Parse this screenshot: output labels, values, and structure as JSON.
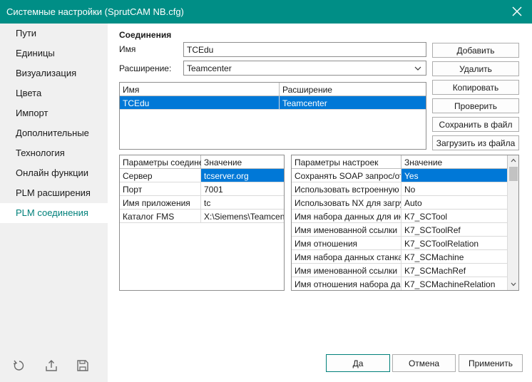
{
  "window": {
    "title": "Системные настройки (SprutCAM NB.cfg)"
  },
  "sidebar": {
    "items": [
      {
        "label": "Пути"
      },
      {
        "label": "Единицы"
      },
      {
        "label": "Визуализация"
      },
      {
        "label": "Цвета"
      },
      {
        "label": "Импорт"
      },
      {
        "label": "Дополнительные"
      },
      {
        "label": "Технология"
      },
      {
        "label": "Онлайн функции"
      },
      {
        "label": "PLM расширения"
      },
      {
        "label": "PLM соединения"
      }
    ],
    "active_index": 9
  },
  "connections": {
    "section_title": "Соединения",
    "name_label": "Имя",
    "name_value": "TCEdu",
    "extension_label": "Расширение:",
    "extension_value": "Teamcenter",
    "table": {
      "columns": [
        "Имя",
        "Расширение"
      ],
      "rows": [
        {
          "name": "TCEdu",
          "extension": "Teamcenter",
          "selected": true
        }
      ]
    },
    "buttons": {
      "add": "Добавить",
      "delete": "Удалить",
      "copy": "Копировать",
      "check": "Проверить",
      "save_file": "Сохранить в файл",
      "load_file": "Загрузить из файла"
    }
  },
  "conn_params": {
    "columns": [
      "Параметры соединения",
      "Значение"
    ],
    "rows": [
      {
        "param": "Сервер",
        "value": "tcserver.org",
        "selected": true
      },
      {
        "param": "Порт",
        "value": "7001",
        "selected": false
      },
      {
        "param": "Имя приложения",
        "value": "tc",
        "selected": false
      },
      {
        "param": "Каталог FMS",
        "value": "X:\\Siemens\\Teamcenter",
        "selected": false
      }
    ]
  },
  "settings_params": {
    "columns": [
      "Параметры настроек",
      "Значение"
    ],
    "rows": [
      {
        "param": "Сохранять SOAP запрос/ответ",
        "value": "Yes",
        "selected": true
      },
      {
        "param": "Использовать встроенную",
        "value": "No",
        "selected": false
      },
      {
        "param": "Использовать NX для загрузки",
        "value": "Auto",
        "selected": false
      },
      {
        "param": "Имя набора данных для инструмента",
        "value": "K7_SCTool",
        "selected": false
      },
      {
        "param": "Имя именованной ссылки",
        "value": "K7_SCToolRef",
        "selected": false
      },
      {
        "param": "Имя отношения",
        "value": "K7_SCToolRelation",
        "selected": false
      },
      {
        "param": "Имя набора данных станка",
        "value": "K7_SCMachine",
        "selected": false
      },
      {
        "param": "Имя именованной ссылки",
        "value": "K7_SCMachRef",
        "selected": false
      },
      {
        "param": "Имя отношения набора данных",
        "value": "K7_SCMachineRelation",
        "selected": false
      }
    ]
  },
  "footer": {
    "ok": "Да",
    "cancel": "Отмена",
    "apply": "Применить"
  },
  "colors": {
    "titlebar": "#008e86",
    "accent": "#00807a",
    "selection": "#0078d7"
  }
}
